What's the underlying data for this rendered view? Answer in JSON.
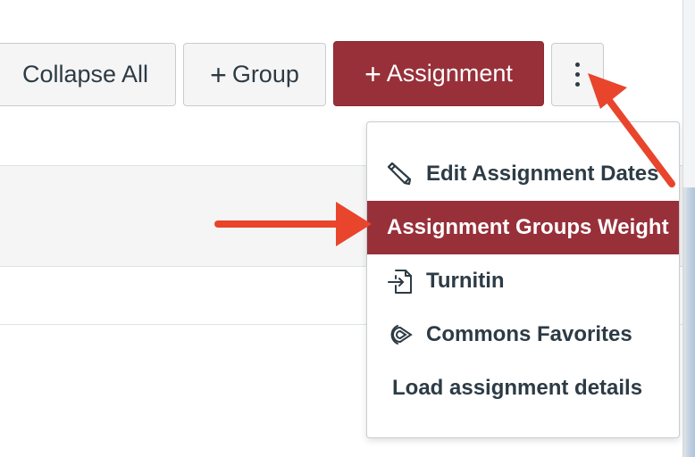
{
  "toolbar": {
    "collapse_label": "Collapse All",
    "group_label": "Group",
    "assignment_label": "Assignment",
    "plus_glyph": "+"
  },
  "menu": {
    "items": [
      {
        "label": "Edit Assignment Dates",
        "icon": "pencil-icon"
      },
      {
        "label": "Assignment Groups Weight",
        "icon": ""
      },
      {
        "label": "Turnitin",
        "icon": "external-tool-icon"
      },
      {
        "label": "Commons Favorites",
        "icon": "commons-icon"
      },
      {
        "label": "Load assignment details",
        "icon": ""
      }
    ]
  },
  "annotations": {
    "arrow_color": "#e8452c",
    "icons": [
      "arrow-to-more-button",
      "arrow-to-groups-weight"
    ]
  },
  "colors": {
    "brand": "#98303a",
    "text": "#2d3b45",
    "button_bg": "#f5f5f5"
  }
}
